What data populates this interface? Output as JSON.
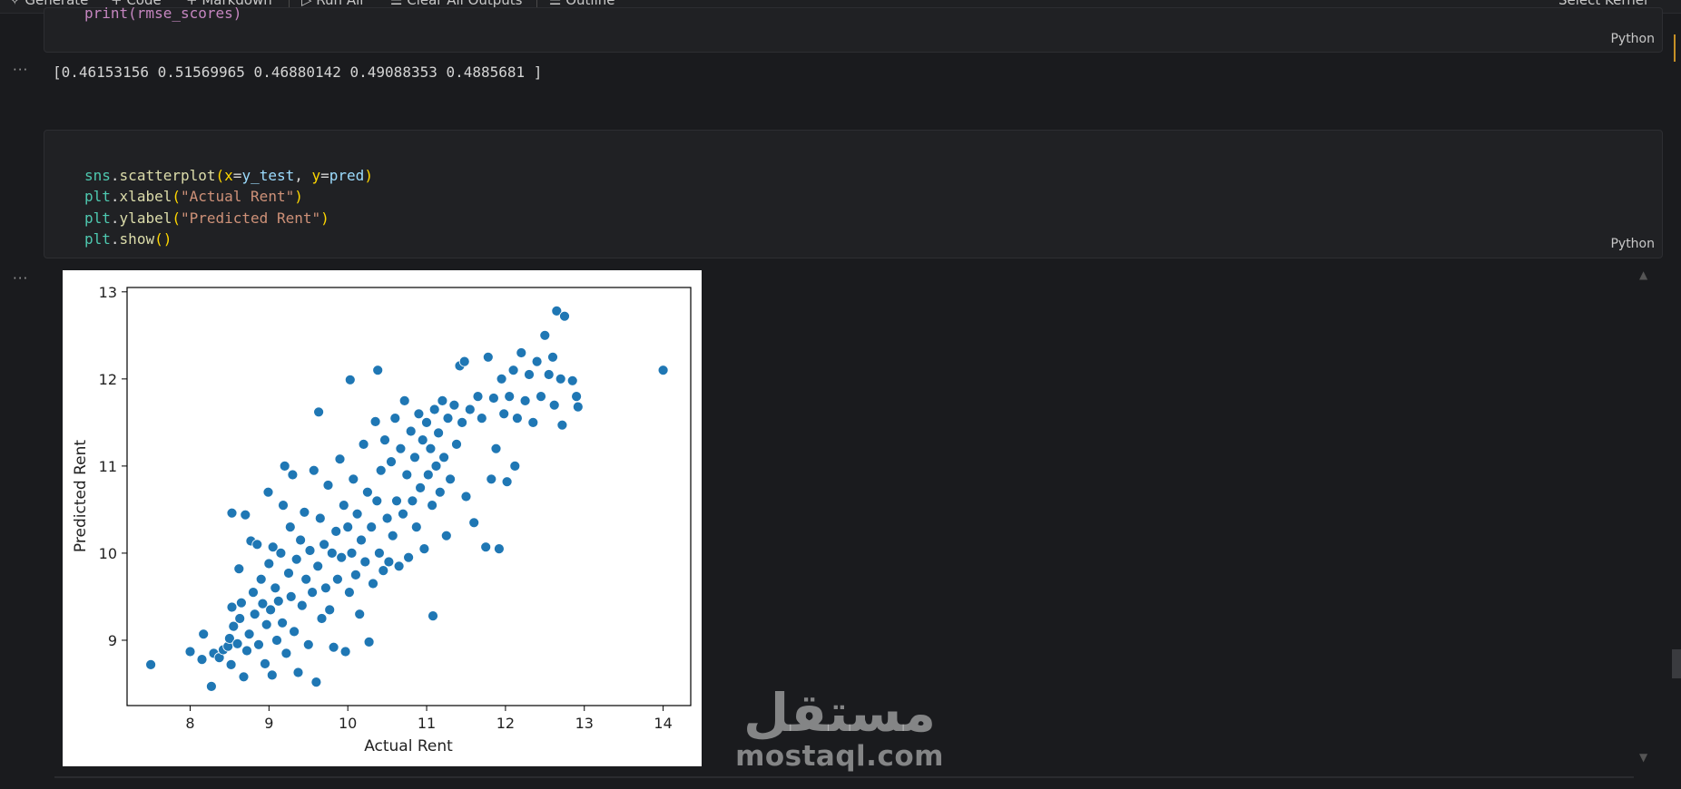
{
  "toolbar": {
    "generate": "✧ Generate",
    "code": "+ Code",
    "markdown": "+ Markdown",
    "run_all": "▷ Run All",
    "clear_outputs": "☰ Clear All Outputs",
    "outline": "☰ Outline",
    "select_kernel": "Select Kernel"
  },
  "cell1": {
    "code_tail": "print(rmse_scores)",
    "language": "Python",
    "output_marker": "···",
    "output": "[0.46153156 0.51569965 0.46880142 0.49088353 0.4885681 ]"
  },
  "cell2": {
    "code": {
      "l1_obj": "sns",
      "l1_fn": "scatterplot",
      "l1_open": "(",
      "l1_k1": "x",
      "l1_eq1": "=",
      "l1_v1": "y_test",
      "l1_comma": ", ",
      "l1_k2": "y",
      "l1_eq2": "=",
      "l1_v2": "pred",
      "l1_close": ")",
      "l2_obj": "plt",
      "l2_fn": "xlabel",
      "l2_open": "(",
      "l2_str": "\"Actual Rent\"",
      "l2_close": ")",
      "l3_obj": "plt",
      "l3_fn": "ylabel",
      "l3_open": "(",
      "l3_str": "\"Predicted Rent\"",
      "l3_close": ")",
      "l4_obj": "plt",
      "l4_fn": "show",
      "l4_parens": "()"
    },
    "language": "Python",
    "output_marker": "···"
  },
  "watermark": {
    "arabic": "مستقل",
    "latin": "mostaql.com"
  },
  "chart_data": {
    "type": "scatter",
    "title": "",
    "xlabel": "Actual Rent",
    "ylabel": "Predicted Rent",
    "xlim": [
      7.2,
      14.35
    ],
    "ylim": [
      8.25,
      13.05
    ],
    "xticks": [
      8,
      9,
      10,
      11,
      12,
      13,
      14
    ],
    "yticks": [
      9,
      10,
      11,
      12,
      13
    ],
    "grid": false,
    "legend": "none",
    "point_color": "#1f77b4",
    "points": [
      [
        7.5,
        8.72
      ],
      [
        8.0,
        8.87
      ],
      [
        8.15,
        8.78
      ],
      [
        8.17,
        9.07
      ],
      [
        8.27,
        8.47
      ],
      [
        8.3,
        8.85
      ],
      [
        8.37,
        8.8
      ],
      [
        8.42,
        8.89
      ],
      [
        8.48,
        8.93
      ],
      [
        8.5,
        9.02
      ],
      [
        8.52,
        8.72
      ],
      [
        8.53,
        9.38
      ],
      [
        8.53,
        10.46
      ],
      [
        8.55,
        9.16
      ],
      [
        8.6,
        8.96
      ],
      [
        8.62,
        9.82
      ],
      [
        8.63,
        9.25
      ],
      [
        8.65,
        9.43
      ],
      [
        8.68,
        8.58
      ],
      [
        8.7,
        10.44
      ],
      [
        8.72,
        8.88
      ],
      [
        8.75,
        9.07
      ],
      [
        8.77,
        10.14
      ],
      [
        8.8,
        9.55
      ],
      [
        8.82,
        9.3
      ],
      [
        8.85,
        10.1
      ],
      [
        8.87,
        8.95
      ],
      [
        8.9,
        9.7
      ],
      [
        8.92,
        9.42
      ],
      [
        8.95,
        8.73
      ],
      [
        8.97,
        9.18
      ],
      [
        8.99,
        10.7
      ],
      [
        9.0,
        9.88
      ],
      [
        9.02,
        9.35
      ],
      [
        9.04,
        8.6
      ],
      [
        9.05,
        10.07
      ],
      [
        9.08,
        9.6
      ],
      [
        9.1,
        9.0
      ],
      [
        9.12,
        9.45
      ],
      [
        9.15,
        10.0
      ],
      [
        9.17,
        9.2
      ],
      [
        9.18,
        10.55
      ],
      [
        9.2,
        11.0
      ],
      [
        9.22,
        8.85
      ],
      [
        9.25,
        9.77
      ],
      [
        9.27,
        10.3
      ],
      [
        9.28,
        9.5
      ],
      [
        9.3,
        10.9
      ],
      [
        9.32,
        9.1
      ],
      [
        9.35,
        9.93
      ],
      [
        9.37,
        8.63
      ],
      [
        9.4,
        10.15
      ],
      [
        9.42,
        9.4
      ],
      [
        9.45,
        10.47
      ],
      [
        9.47,
        9.7
      ],
      [
        9.5,
        8.95
      ],
      [
        9.52,
        10.03
      ],
      [
        9.55,
        9.55
      ],
      [
        9.57,
        10.95
      ],
      [
        9.6,
        8.52
      ],
      [
        9.62,
        9.85
      ],
      [
        9.63,
        11.62
      ],
      [
        9.65,
        10.4
      ],
      [
        9.67,
        9.25
      ],
      [
        9.7,
        10.1
      ],
      [
        9.72,
        9.6
      ],
      [
        9.75,
        10.78
      ],
      [
        9.77,
        9.35
      ],
      [
        9.8,
        10.0
      ],
      [
        9.82,
        8.92
      ],
      [
        9.85,
        10.25
      ],
      [
        9.87,
        9.7
      ],
      [
        9.9,
        11.08
      ],
      [
        9.92,
        9.95
      ],
      [
        9.95,
        10.55
      ],
      [
        9.97,
        8.87
      ],
      [
        10.0,
        10.3
      ],
      [
        10.02,
        9.55
      ],
      [
        10.03,
        11.99
      ],
      [
        10.05,
        10.0
      ],
      [
        10.07,
        10.85
      ],
      [
        10.1,
        9.75
      ],
      [
        10.12,
        10.45
      ],
      [
        10.15,
        9.3
      ],
      [
        10.17,
        10.15
      ],
      [
        10.2,
        11.25
      ],
      [
        10.22,
        9.9
      ],
      [
        10.25,
        10.7
      ],
      [
        10.27,
        8.98
      ],
      [
        10.3,
        10.3
      ],
      [
        10.32,
        9.65
      ],
      [
        10.35,
        11.51
      ],
      [
        10.37,
        10.6
      ],
      [
        10.38,
        12.1
      ],
      [
        10.4,
        10.0
      ],
      [
        10.42,
        10.95
      ],
      [
        10.45,
        9.8
      ],
      [
        10.47,
        11.3
      ],
      [
        10.5,
        10.4
      ],
      [
        10.52,
        9.9
      ],
      [
        10.55,
        11.05
      ],
      [
        10.57,
        10.2
      ],
      [
        10.6,
        11.55
      ],
      [
        10.62,
        10.6
      ],
      [
        10.65,
        9.85
      ],
      [
        10.67,
        11.2
      ],
      [
        10.7,
        10.45
      ],
      [
        10.72,
        11.75
      ],
      [
        10.75,
        10.9
      ],
      [
        10.77,
        9.95
      ],
      [
        10.8,
        11.4
      ],
      [
        10.82,
        10.6
      ],
      [
        10.85,
        11.1
      ],
      [
        10.87,
        10.3
      ],
      [
        10.9,
        11.6
      ],
      [
        10.92,
        10.75
      ],
      [
        10.95,
        11.3
      ],
      [
        10.97,
        10.05
      ],
      [
        11.0,
        11.5
      ],
      [
        11.02,
        10.9
      ],
      [
        11.05,
        11.2
      ],
      [
        11.07,
        10.55
      ],
      [
        11.08,
        9.28
      ],
      [
        11.1,
        11.65
      ],
      [
        11.12,
        11.0
      ],
      [
        11.15,
        11.38
      ],
      [
        11.17,
        10.7
      ],
      [
        11.2,
        11.75
      ],
      [
        11.22,
        11.1
      ],
      [
        11.25,
        10.2
      ],
      [
        11.27,
        11.55
      ],
      [
        11.3,
        10.85
      ],
      [
        11.35,
        11.7
      ],
      [
        11.38,
        11.25
      ],
      [
        11.42,
        12.15
      ],
      [
        11.45,
        11.5
      ],
      [
        11.48,
        12.2
      ],
      [
        11.5,
        10.65
      ],
      [
        11.55,
        11.65
      ],
      [
        11.6,
        10.35
      ],
      [
        11.65,
        11.8
      ],
      [
        11.7,
        11.55
      ],
      [
        11.75,
        10.07
      ],
      [
        11.78,
        12.25
      ],
      [
        11.82,
        10.85
      ],
      [
        11.85,
        11.78
      ],
      [
        11.88,
        11.2
      ],
      [
        11.92,
        10.05
      ],
      [
        11.95,
        12.0
      ],
      [
        11.98,
        11.6
      ],
      [
        12.02,
        10.82
      ],
      [
        12.05,
        11.8
      ],
      [
        12.1,
        12.1
      ],
      [
        12.12,
        11.0
      ],
      [
        12.15,
        11.55
      ],
      [
        12.2,
        12.3
      ],
      [
        12.25,
        11.75
      ],
      [
        12.3,
        12.05
      ],
      [
        12.35,
        11.5
      ],
      [
        12.4,
        12.2
      ],
      [
        12.45,
        11.8
      ],
      [
        12.5,
        12.5
      ],
      [
        12.55,
        12.05
      ],
      [
        12.6,
        12.25
      ],
      [
        12.62,
        11.7
      ],
      [
        12.65,
        12.78
      ],
      [
        12.7,
        12.0
      ],
      [
        12.72,
        11.47
      ],
      [
        12.75,
        12.72
      ],
      [
        12.85,
        11.98
      ],
      [
        12.9,
        11.8
      ],
      [
        12.92,
        11.68
      ],
      [
        14.0,
        12.1
      ]
    ]
  }
}
